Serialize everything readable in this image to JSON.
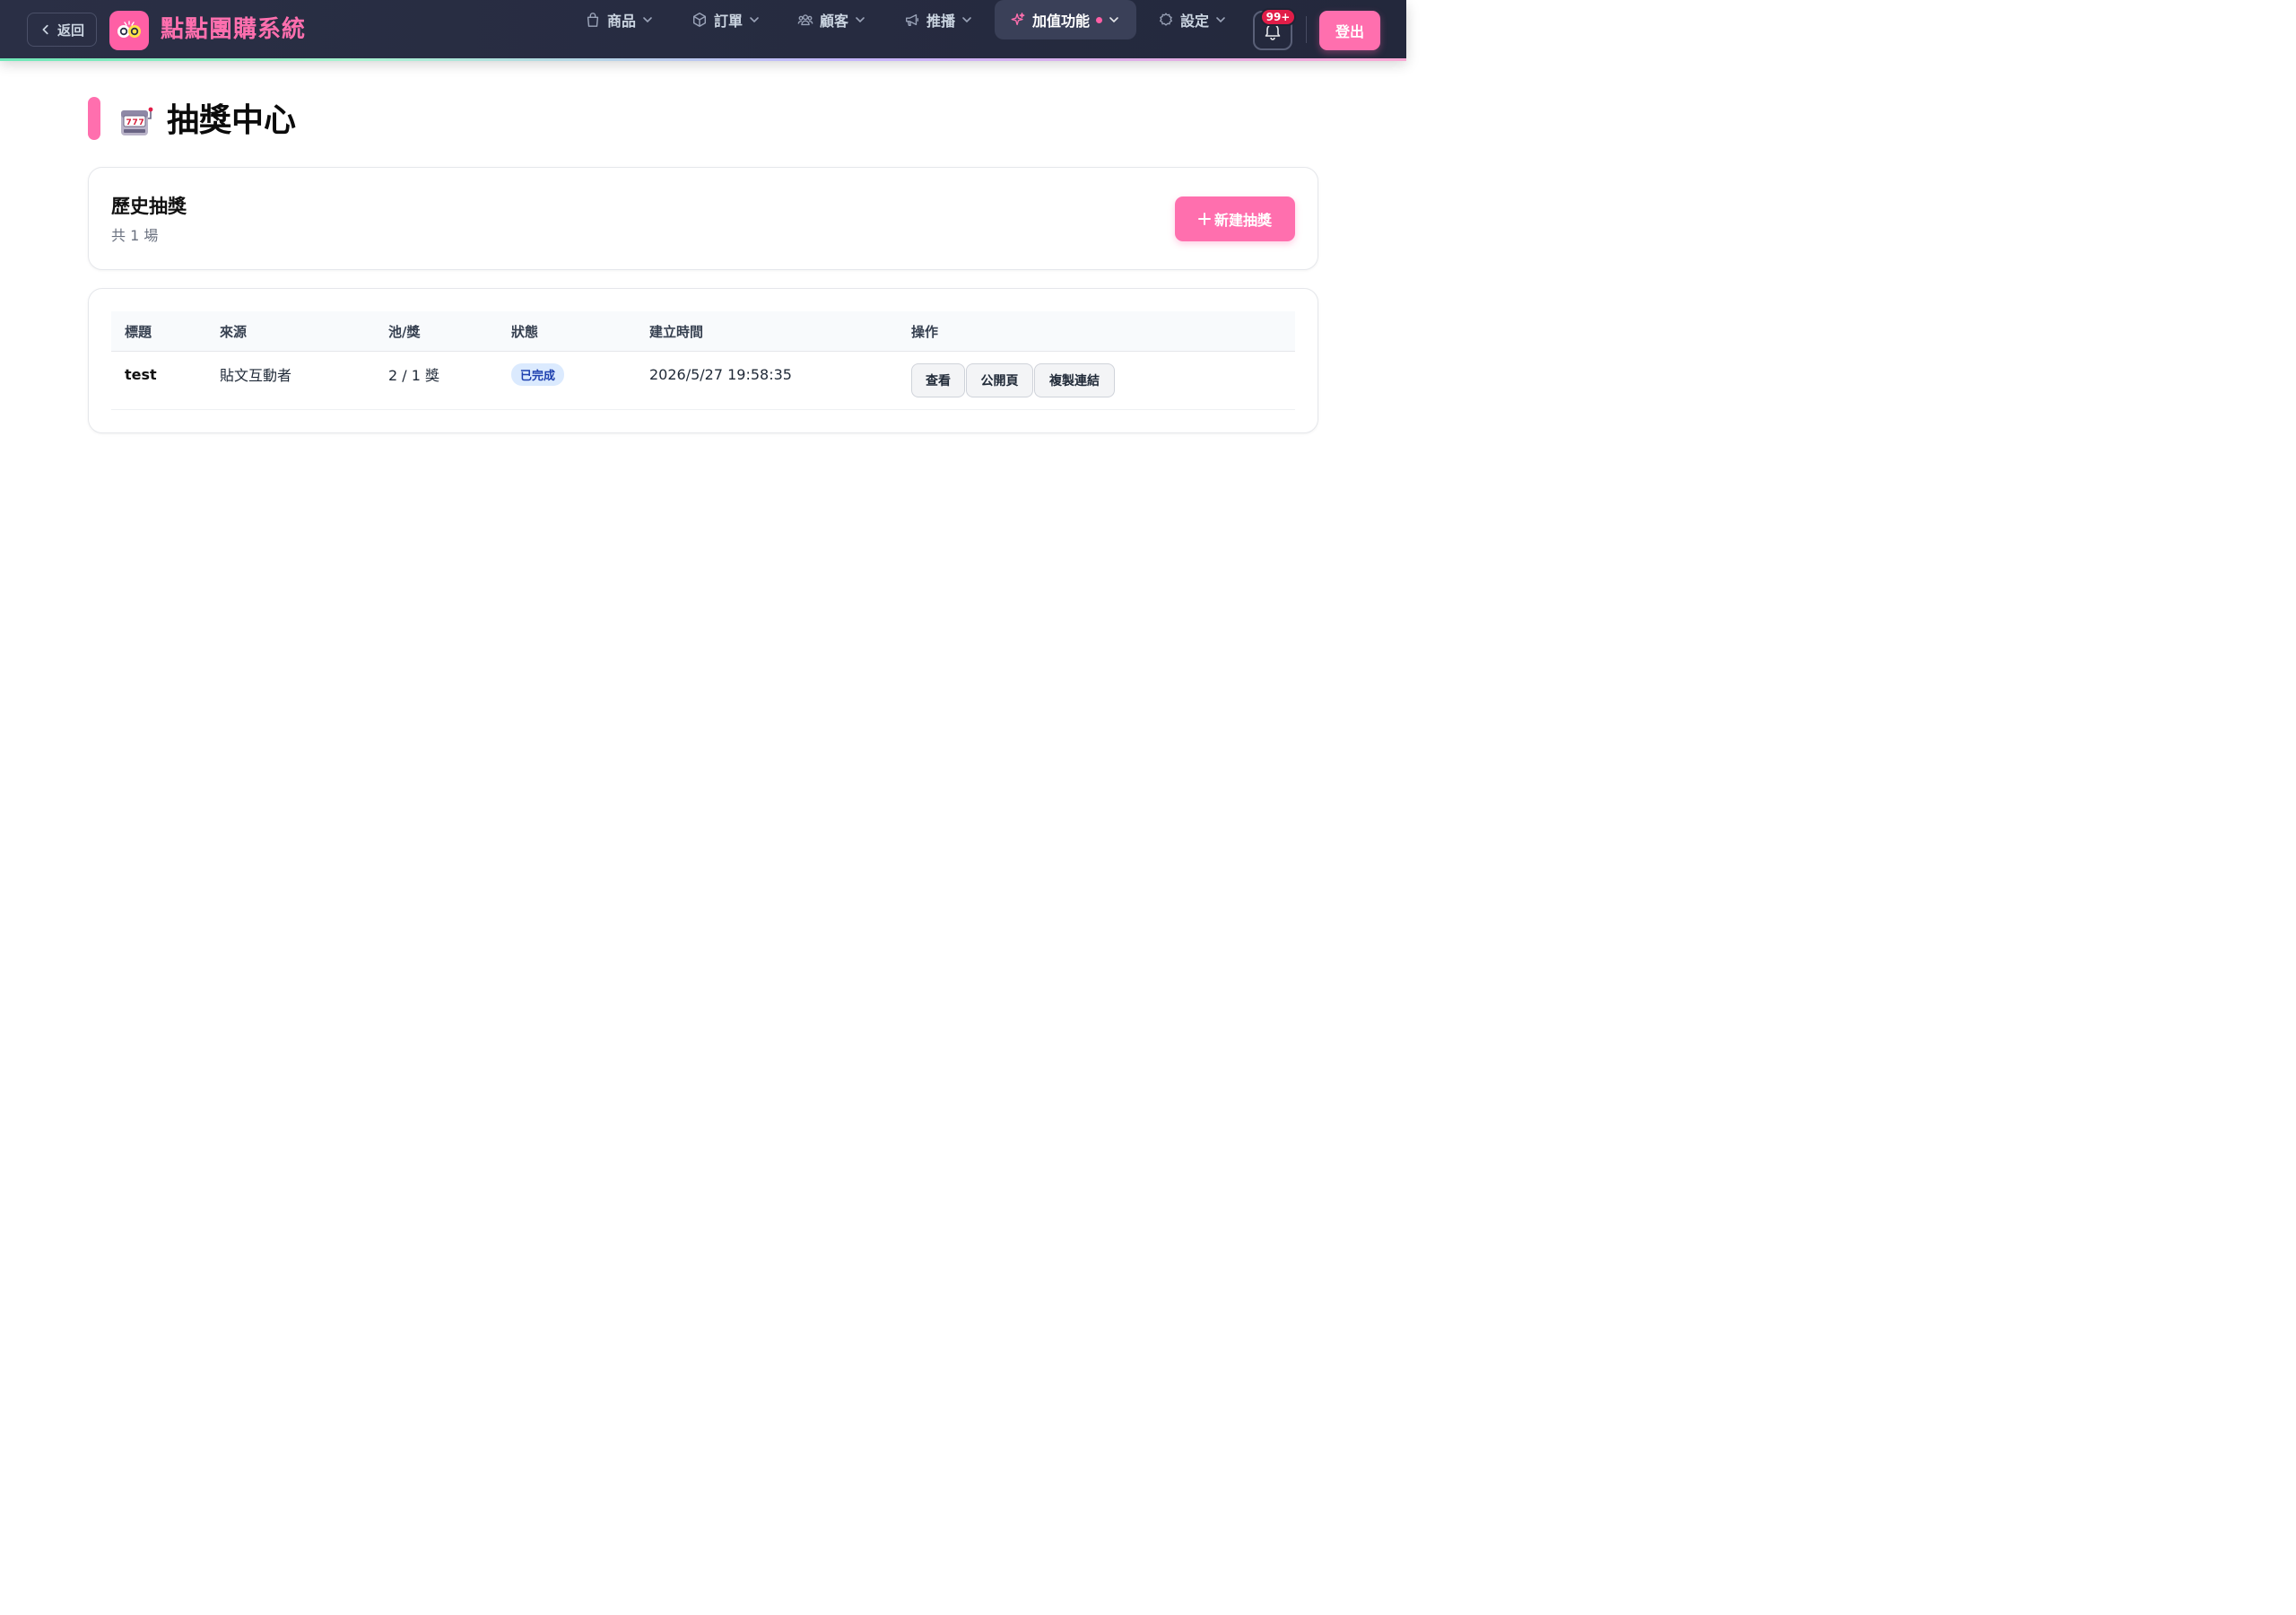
{
  "app": {
    "back_label": "返回",
    "brand_name": "點點團購系統"
  },
  "nav": {
    "items": [
      {
        "label": "商品",
        "icon": "bag-icon"
      },
      {
        "label": "訂單",
        "icon": "box-icon"
      },
      {
        "label": "顧客",
        "icon": "users-icon"
      },
      {
        "label": "推播",
        "icon": "megaphone-icon"
      },
      {
        "label": "加值功能",
        "icon": "sparkles-icon",
        "active": true
      },
      {
        "label": "設定",
        "icon": "gear-icon"
      }
    ],
    "notification_badge": "99+",
    "logout_label": "登出"
  },
  "page": {
    "title": "抽獎中心",
    "emoji_icon": "slot-machine-icon"
  },
  "history": {
    "title": "歷史抽獎",
    "count_text": "共 1 場",
    "new_button_label": "新建抽獎"
  },
  "table": {
    "columns": [
      "標題",
      "來源",
      "池/獎",
      "狀態",
      "建立時間",
      "操作"
    ],
    "rows": [
      {
        "title": "test",
        "source": "貼文互動者",
        "pool_prize": "2 / 1 獎",
        "status": "已完成",
        "created_at": "2026/5/27 19:58:35",
        "actions": [
          "查看",
          "公開頁",
          "複製連結"
        ]
      }
    ]
  },
  "colors": {
    "brand_pink": "#ff6fae",
    "nav_bg": "#262b40",
    "status_badge_bg": "#dbeafe",
    "status_badge_text": "#1e40af",
    "notification_red": "#e11d48"
  }
}
